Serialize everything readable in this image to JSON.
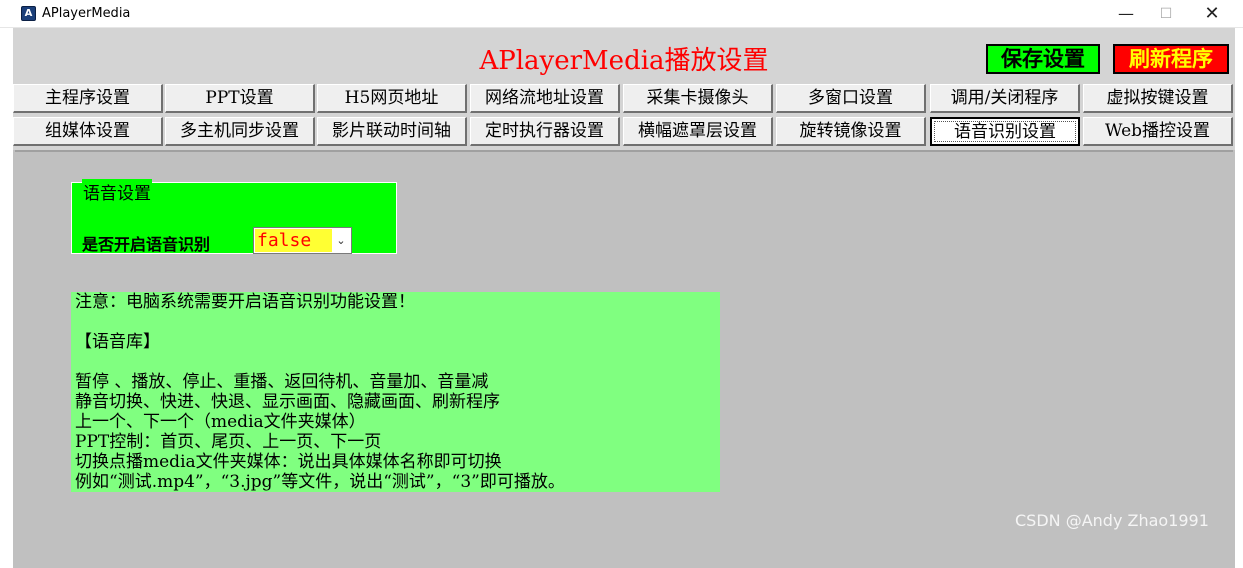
{
  "window": {
    "title": "APlayerMedia",
    "icon_label": "A",
    "minimize_glyph": "—",
    "maximize_glyph": "☐",
    "close_glyph": "✕"
  },
  "header": {
    "title": "APlayerMedia播放设置",
    "save_label": "保存设置",
    "refresh_label": "刷新程序"
  },
  "tabs_row1": [
    "主程序设置",
    "PPT设置",
    "H5网页地址",
    "网络流地址设置",
    "采集卡摄像头",
    "多窗口设置",
    "调用/关闭程序",
    "虚拟按键设置"
  ],
  "tabs_row2": [
    "组媒体设置",
    "多主机同步设置",
    "影片联动时间轴",
    "定时执行器设置",
    "横幅遮罩层设置",
    "旋转镜像设置",
    "语音识别设置",
    "Web播控设置"
  ],
  "active_tab": "语音识别设置",
  "voice_group": {
    "legend": "语音设置",
    "label": "是否开启语音识别",
    "select_value": "false"
  },
  "notice_lines": [
    "注意：电脑系统需要开启语音识别功能设置！",
    "",
    "【语音库】",
    "",
    "暂停 、播放、停止、重播、返回待机、音量加、音量减",
    "静音切换、快进、快退、显示画面、隐藏画面、刷新程序",
    "上一个、下一个（media文件夹媒体）",
    "PPT控制：首页、尾页、上一页、下一页",
    "切换点播media文件夹媒体：说出具体媒体名称即可切换",
    "例如“测试.mp4”，“3.jpg”等文件，说出“测试”，“3”即可播放。"
  ],
  "watermark": "CSDN @Andy Zhao1991",
  "colors": {
    "title_red": "#ff0000",
    "save_green": "#00ff00",
    "refresh_red": "#ff0000",
    "refresh_text_yellow": "#ffff00",
    "group_green": "#00ff00",
    "notice_green": "#80ff80",
    "select_highlight": "#ffff33"
  }
}
